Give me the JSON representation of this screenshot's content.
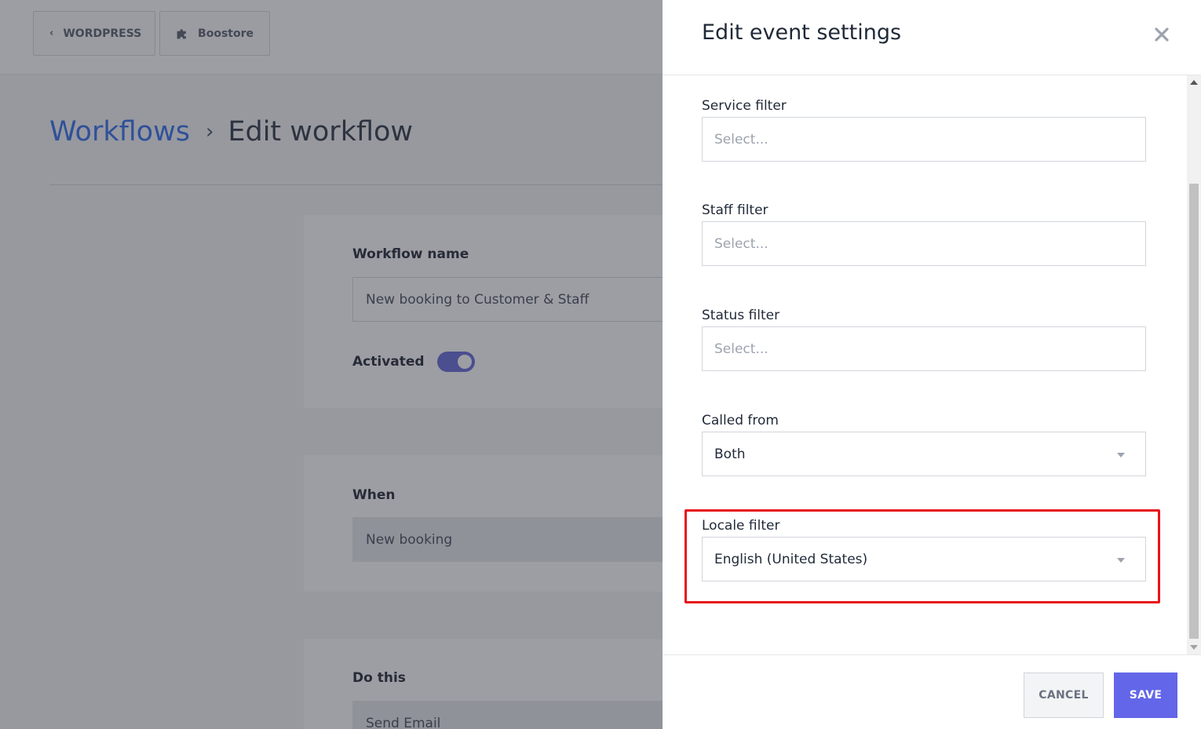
{
  "topbar": {
    "wordpress_label": "WORDPRESS",
    "boostore_label": "Boostore"
  },
  "breadcrumb": {
    "parent": "Workflows",
    "separator": "›",
    "current": "Edit workflow"
  },
  "workflow": {
    "name_label": "Workflow name",
    "name_value": "New booking to Customer & Staff",
    "activated_label": "Activated",
    "activated": true,
    "when_label": "When",
    "when_value": "New booking",
    "do_label": "Do this",
    "do_value": "Send Email"
  },
  "panel": {
    "title": "Edit event settings",
    "fields": {
      "service": {
        "label": "Service filter",
        "placeholder": "Select..."
      },
      "staff": {
        "label": "Staff filter",
        "placeholder": "Select..."
      },
      "status": {
        "label": "Status filter",
        "placeholder": "Select..."
      },
      "called_from": {
        "label": "Called from",
        "value": "Both"
      },
      "locale": {
        "label": "Locale filter",
        "value": "English (United States)"
      }
    },
    "highlight_color": "#e8121b",
    "cancel_label": "CANCEL",
    "save_label": "SAVE",
    "accent_color": "#6366e8"
  }
}
